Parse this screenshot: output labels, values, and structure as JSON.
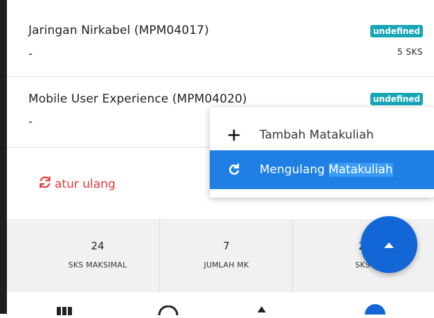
{
  "courses": [
    {
      "title": "Jaringan Nirkabel (MPM04017)",
      "dash": "-",
      "badge": "undefined",
      "sks": "5 SKS"
    },
    {
      "title": "Mobile User Experience (MPM04020)",
      "dash": "-",
      "badge": "undefined"
    }
  ],
  "reset": {
    "label": "atur ulang",
    "color": "#e53935"
  },
  "stats": [
    {
      "value": "24",
      "label": "SKS MAKSIMAL"
    },
    {
      "value": "7",
      "label": "JUMLAH MK"
    },
    {
      "value": "26",
      "label": "SKS"
    }
  ],
  "menu": {
    "items": [
      {
        "icon": "plus-icon",
        "label": "Tambah Matakuliah"
      },
      {
        "icon": "redo-icon",
        "label_part1": "Mengulang",
        "label_part2": "Matakuliah"
      }
    ],
    "active_color": "#1f7fe5"
  },
  "fab": {
    "icon": "caret-up-icon",
    "color": "#1266d6"
  },
  "badge_color": "#16a6b6"
}
